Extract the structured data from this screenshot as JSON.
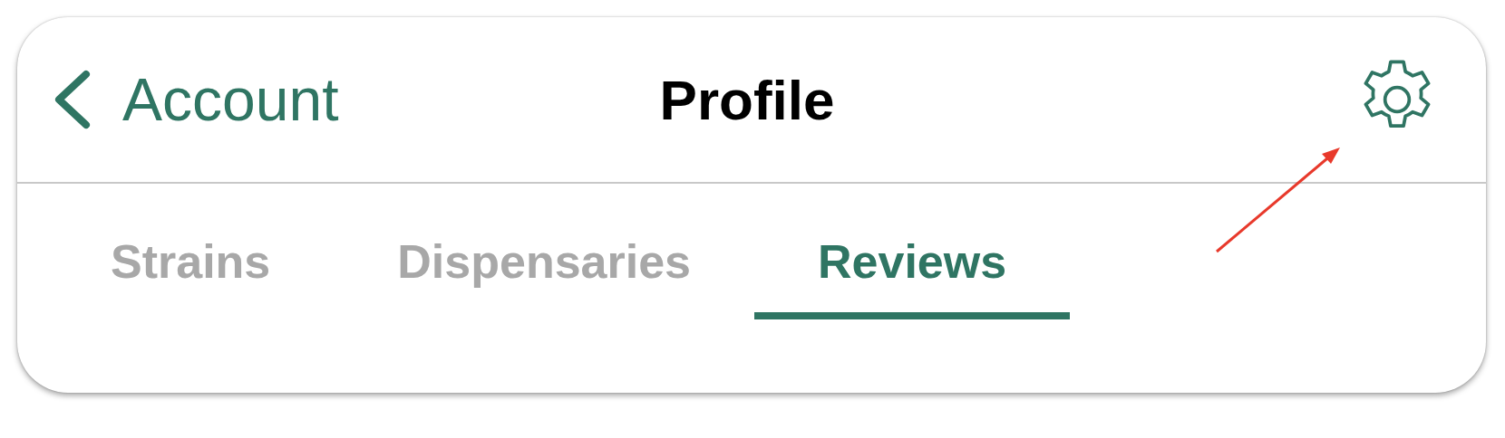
{
  "nav_bar": {
    "back_label": "Account",
    "title": "Profile"
  },
  "tabs": [
    {
      "label": "Strains",
      "selected": false
    },
    {
      "label": "Dispensaries",
      "selected": false
    },
    {
      "label": "Reviews",
      "selected": true
    }
  ]
}
